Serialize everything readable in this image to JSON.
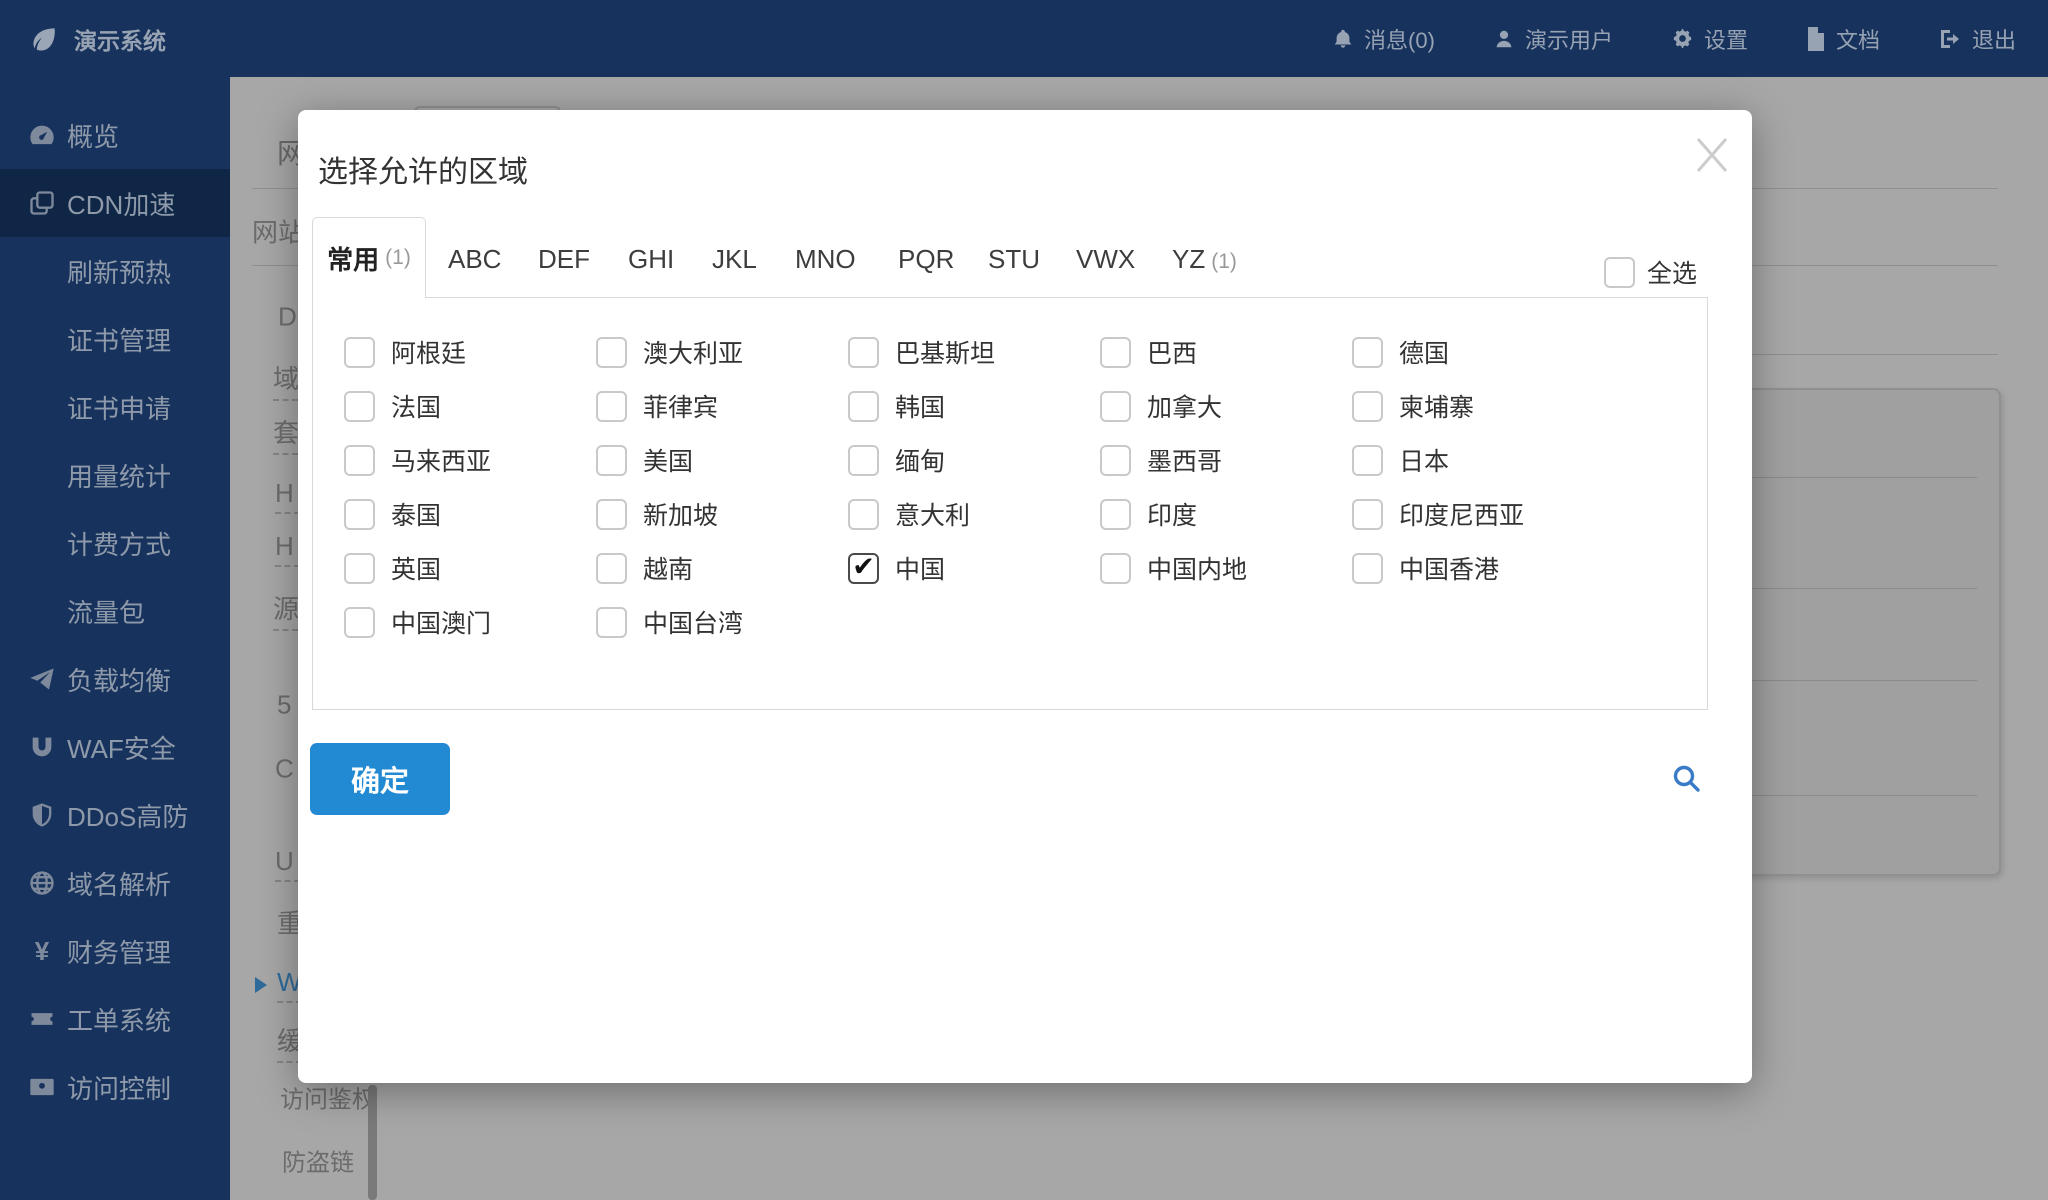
{
  "colors": {
    "navy": "#17335d",
    "navy_active": "#0f2646",
    "accent": "#2289d3",
    "search_blue": "#3a7bc8",
    "dim_link": "#2e6b9b",
    "modal_text": "#333333",
    "border": "#d9d9d9"
  },
  "navbar": {
    "brand": "演示系统",
    "items": [
      {
        "label": "消息(0)",
        "icon": "bell"
      },
      {
        "label": "演示用户",
        "icon": "user"
      },
      {
        "label": "设置",
        "icon": "gear"
      },
      {
        "label": "文档",
        "icon": "document"
      },
      {
        "label": "退出",
        "icon": "logout"
      }
    ]
  },
  "sidebar": {
    "items": [
      {
        "label": "概览",
        "icon": "gauge"
      },
      {
        "label": "CDN加速",
        "icon": "layers",
        "active": true
      },
      {
        "label": "刷新预热"
      },
      {
        "label": "证书管理"
      },
      {
        "label": "证书申请"
      },
      {
        "label": "用量统计"
      },
      {
        "label": "计费方式"
      },
      {
        "label": "流量包"
      },
      {
        "label": "负载均衡",
        "icon": "paper-plane"
      },
      {
        "label": "WAF安全",
        "icon": "magnet"
      },
      {
        "label": "DDoS高防",
        "icon": "shield"
      },
      {
        "label": "域名解析",
        "icon": "globe"
      },
      {
        "label": "财务管理",
        "icon": "yen"
      },
      {
        "label": "工单系统",
        "icon": "ticket"
      },
      {
        "label": "访问控制",
        "icon": "id-card"
      }
    ]
  },
  "bg": {
    "items": [
      "网",
      "网站",
      "D",
      "域",
      "套",
      "H",
      "H",
      "源",
      "5",
      "C",
      "U",
      "重",
      "W",
      "缓",
      "访问鉴权",
      "防盗链"
    ]
  },
  "modal": {
    "title": "选择允许的区域",
    "close_icon": "close-x",
    "tabs": [
      {
        "label": "常用",
        "count": "(1)",
        "active": true
      },
      {
        "label": "ABC",
        "count": ""
      },
      {
        "label": "DEF",
        "count": ""
      },
      {
        "label": "GHI",
        "count": ""
      },
      {
        "label": "JKL",
        "count": ""
      },
      {
        "label": "MNO",
        "count": ""
      },
      {
        "label": "PQR",
        "count": ""
      },
      {
        "label": "STU",
        "count": ""
      },
      {
        "label": "VWX",
        "count": ""
      },
      {
        "label": "YZ",
        "count": "(1)"
      }
    ],
    "select_all_label": "全选",
    "regions": [
      {
        "label": "阿根廷",
        "checked": false
      },
      {
        "label": "澳大利亚",
        "checked": false
      },
      {
        "label": "巴基斯坦",
        "checked": false
      },
      {
        "label": "巴西",
        "checked": false
      },
      {
        "label": "德国",
        "checked": false
      },
      {
        "label": "法国",
        "checked": false
      },
      {
        "label": "菲律宾",
        "checked": false
      },
      {
        "label": "韩国",
        "checked": false
      },
      {
        "label": "加拿大",
        "checked": false
      },
      {
        "label": "柬埔寨",
        "checked": false
      },
      {
        "label": "马来西亚",
        "checked": false
      },
      {
        "label": "美国",
        "checked": false
      },
      {
        "label": "缅甸",
        "checked": false
      },
      {
        "label": "墨西哥",
        "checked": false
      },
      {
        "label": "日本",
        "checked": false
      },
      {
        "label": "泰国",
        "checked": false
      },
      {
        "label": "新加坡",
        "checked": false
      },
      {
        "label": "意大利",
        "checked": false
      },
      {
        "label": "印度",
        "checked": false
      },
      {
        "label": "印度尼西亚",
        "checked": false
      },
      {
        "label": "英国",
        "checked": false
      },
      {
        "label": "越南",
        "checked": false
      },
      {
        "label": "中国",
        "checked": true
      },
      {
        "label": "中国内地",
        "checked": false
      },
      {
        "label": "中国香港",
        "checked": false
      },
      {
        "label": "中国澳门",
        "checked": false
      },
      {
        "label": "中国台湾",
        "checked": false
      }
    ],
    "confirm_label": "确定",
    "search_icon": "magnifier"
  }
}
